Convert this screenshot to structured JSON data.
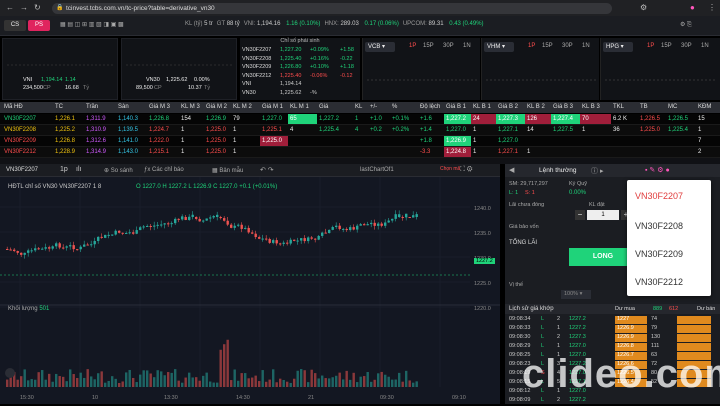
{
  "browser": {
    "url": "tcinvest.tcbs.com.vn/tc-price?table=derivative_vn30"
  },
  "toolbar": {
    "cs_label": "CS",
    "ps_label": "PS",
    "tickers": [
      {
        "label": "KL (tỷ)",
        "value": "5 tr",
        "color": "#cccccc"
      },
      {
        "label": "GT",
        "value": "88 tỷ",
        "color": "#cccccc"
      },
      {
        "label": "VNI:",
        "value": "1,194.16",
        "color": "#cccccc"
      },
      {
        "label": "",
        "value": "1.16 (0.10%)",
        "color": "#1fd37a"
      },
      {
        "label": "HNX:",
        "value": "289.03",
        "color": "#cccccc"
      },
      {
        "label": "",
        "value": "0.17 (0.06%)",
        "color": "#1fd37a"
      },
      {
        "label": "UPCOM:",
        "value": "89.31",
        "color": "#cccccc"
      },
      {
        "label": "",
        "value": "0.43 (0.49%)",
        "color": "#1fd37a"
      }
    ]
  },
  "index_panels": [
    {
      "name": "VNI",
      "value": "1,194.14",
      "change": "1.14",
      "vol": "234,500",
      "vol_unit": "CP",
      "val": "16.68",
      "val_unit": "Tỷ"
    },
    {
      "name": "VN30",
      "value": "1,225.62",
      "change": "0.00%",
      "vol": "89,500",
      "vol_unit": "CP",
      "val": "10.37",
      "val_unit": "Tỷ"
    }
  ],
  "derivatives_panel": {
    "header": "Chỉ số phái sinh",
    "rows": [
      {
        "sym": "VN30F2207",
        "price": "1,227.20",
        "pct": "+0.09%",
        "chg": "+1.58",
        "color": "#1fd37a"
      },
      {
        "sym": "VN30F2208",
        "price": "1,225.40",
        "pct": "+0.16%",
        "chg": "-0.22",
        "color": "#1fd37a"
      },
      {
        "sym": "VN30F2209",
        "price": "1,226.80",
        "pct": "+0.10%",
        "chg": "+1.18",
        "color": "#1fd37a"
      },
      {
        "sym": "VN30F2212",
        "price": "1,225.40",
        "pct": "-0.06%",
        "chg": "-0.12",
        "color": "#ff4d4d"
      },
      {
        "sym": "VNI",
        "price": "1,194.14",
        "pct": "",
        "chg": "",
        "color": "#cccccc"
      },
      {
        "sym": "VN30",
        "price": "1,225.62",
        "pct": "-%",
        "chg": "",
        "color": "#cccccc"
      }
    ]
  },
  "symbol_panels": [
    {
      "symbol": "VCB",
      "tabs": [
        "1P",
        "15P",
        "30P",
        "1N"
      ]
    },
    {
      "symbol": "VHM",
      "tabs": [
        "1P",
        "15P",
        "30P",
        "1N"
      ]
    },
    {
      "symbol": "HPG",
      "tabs": [
        "1P",
        "15P",
        "30P",
        "1N"
      ]
    }
  ],
  "table": {
    "headers": [
      "Mã HĐ",
      "TC",
      "Trần",
      "Sàn",
      "Giá M 3",
      "KL M 3",
      "Giá M 2",
      "KL M 2",
      "Giá M 1",
      "KL M 1",
      "Giá",
      "KL",
      "+/-",
      "%",
      "Độ lệch",
      "Giá B 1",
      "KL B 1",
      "Giá B 2",
      "KL B 2",
      "Giá B 3",
      "KL B 3",
      "TKL",
      "TB",
      "MC",
      "KĐM"
    ],
    "rows": [
      {
        "sym": "VN30F2207",
        "tc": "1,226.1",
        "tran": "1,311.9",
        "san": "1,140.3",
        "gm3": "1,226.8",
        "klm3": "154",
        "gm2": "1,226.9",
        "klm2": "79",
        "gm1": "1,227.0",
        "klm1": "65",
        "gia": "1,227.2",
        "kl": "1",
        "chg": "+1.0",
        "pct": "+0.1%",
        "dl": "+1.6",
        "gb1": "1,227.2",
        "klb1": "24",
        "gb2": "1,227.3",
        "klb2": "126",
        "gb3": "1,227.4",
        "klb3": "70",
        "tkl": "6.2 K",
        "tb": "1,226.5",
        "mc": "1,226.5",
        "kdm": "15"
      },
      {
        "sym": "VN30F2208",
        "tc": "1,225.2",
        "tran": "1,310.9",
        "san": "1,139.5",
        "gm3": "1,224.7",
        "klm3": "1",
        "gm2": "1,225.0",
        "klm2": "1",
        "gm1": "1,225.1",
        "klm1": "4",
        "gia": "1,225.4",
        "kl": "4",
        "chg": "+0.2",
        "pct": "+0.2%",
        "dl": "+1.4",
        "gb1": "1,227.0",
        "klb1": "1",
        "gb2": "1,227.1",
        "klb2": "14",
        "gb3": "1,227.5",
        "klb3": "1",
        "tkl": "36",
        "tb": "1,225.0",
        "mc": "1,225.4",
        "kdm": "1"
      },
      {
        "sym": "VN30F2209",
        "tc": "1,226.8",
        "tran": "1,312.6",
        "san": "1,141.0",
        "gm3": "1,222.0",
        "klm3": "1",
        "gm2": "1,225.0",
        "klm2": "1",
        "gm1": "1,225.0",
        "klm1": "",
        "gia": "",
        "kl": "",
        "chg": "",
        "pct": "",
        "dl": "+1.8",
        "gb1": "1,226.9",
        "klb1": "1",
        "gb2": "1,227.0",
        "klb2": "",
        "gb3": "",
        "klb3": "",
        "tkl": "",
        "tb": "",
        "mc": "",
        "kdm": "7"
      },
      {
        "sym": "VN30F2212",
        "tc": "1,228.9",
        "tran": "1,314.9",
        "san": "1,143.0",
        "gm3": "1,215.1",
        "klm3": "1",
        "gm2": "1,225.0",
        "klm2": "1",
        "gm1": "",
        "klm1": "",
        "gia": "",
        "kl": "",
        "chg": "",
        "pct": "",
        "dl": "-3.3",
        "gb1": "1,224.8",
        "klb1": "1",
        "gb2": "1,227.1",
        "klb2": "1",
        "gb3": "",
        "klb3": "",
        "tkl": "",
        "tb": "",
        "mc": "",
        "kdm": "2"
      }
    ]
  },
  "chart": {
    "symbol": "VN30F2207",
    "toolbar": [
      "So sánh",
      "Các chỉ báo",
      "Bản mẫu"
    ],
    "legend": "HĐTL chỉ số VN30   VN30F2207   1   8",
    "ohlc": "O 1227.0  H 1227.2  L 1226.9  C 1227.0  +0.1 (+0.01%)",
    "layout_label": "lastChartOf1",
    "price_tag": "1227.2",
    "volume_label": "Khối lượng",
    "volume_value": "501",
    "x_labels": [
      "15:30",
      "10",
      "13:30",
      "14:30",
      "21",
      "09:30",
      "09:10"
    ],
    "y_labels": [
      "1240.0",
      "1235.0",
      "1230.0",
      "1225.0",
      "1220.0"
    ],
    "chon_mua": "Chọn mã"
  },
  "order_panel": {
    "title": "Lệnh thường",
    "sm": "SM: 29,717,297",
    "ky_quy": "Ký Quỹ",
    "l1": "L: 1",
    "s1": "S: 1",
    "ky_quy_pct": "0.00%",
    "lai_chua": "Lãi chưa đóng",
    "kl_dat": "KL đặt",
    "qty": "1",
    "gia_bq": "Giá bảo vốn",
    "tong_lai": "TỔNG LÃI",
    "long_label": "LONG",
    "vi_the": "Vị thế",
    "pct100": "100%",
    "history_title": "Lịch sử giá khớp",
    "du_mua": "Dư mua",
    "du_ban": "Dư bán",
    "du_mua_val1": "889",
    "du_mua_val2": "612",
    "history": [
      {
        "t": "09:08:34",
        "s": "L",
        "kl": "2",
        "p": "1227.2"
      },
      {
        "t": "09:08:33",
        "s": "L",
        "kl": "1",
        "p": "1227.2"
      },
      {
        "t": "09:08:30",
        "s": "L",
        "kl": "2",
        "p": "1227.3"
      },
      {
        "t": "09:08:29",
        "s": "L",
        "kl": "1",
        "p": "1227.0"
      },
      {
        "t": "09:08:25",
        "s": "L",
        "kl": "1",
        "p": "1227.0"
      },
      {
        "t": "09:08:23",
        "s": "L",
        "kl": "3",
        "p": "1227.2"
      },
      {
        "t": "09:08:19",
        "s": "S",
        "kl": "4",
        "p": "1227.0"
      },
      {
        "t": "09:08:15",
        "s": "L",
        "kl": "5",
        "p": "1227.1"
      },
      {
        "t": "09:08:12",
        "s": "L",
        "kl": "1",
        "p": "1227.0"
      },
      {
        "t": "09:08:09",
        "s": "L",
        "kl": "2",
        "p": "1227.2"
      }
    ],
    "depth": [
      {
        "p": "1227",
        "v": "74"
      },
      {
        "p": "1226.9",
        "v": "79"
      },
      {
        "p": "1226.9",
        "v": "130"
      },
      {
        "p": "1226.8",
        "v": "111"
      },
      {
        "p": "1226.7",
        "v": "63"
      },
      {
        "p": "1226.6",
        "v": "72"
      },
      {
        "p": "1226.5",
        "v": "80"
      },
      {
        "p": "1226.4",
        "v": "52"
      }
    ]
  },
  "dropdown": {
    "items": [
      "VN30F2207",
      "VN30F2208",
      "VN30F2209",
      "VN30F2212"
    ]
  },
  "watermark": "clideo.com"
}
